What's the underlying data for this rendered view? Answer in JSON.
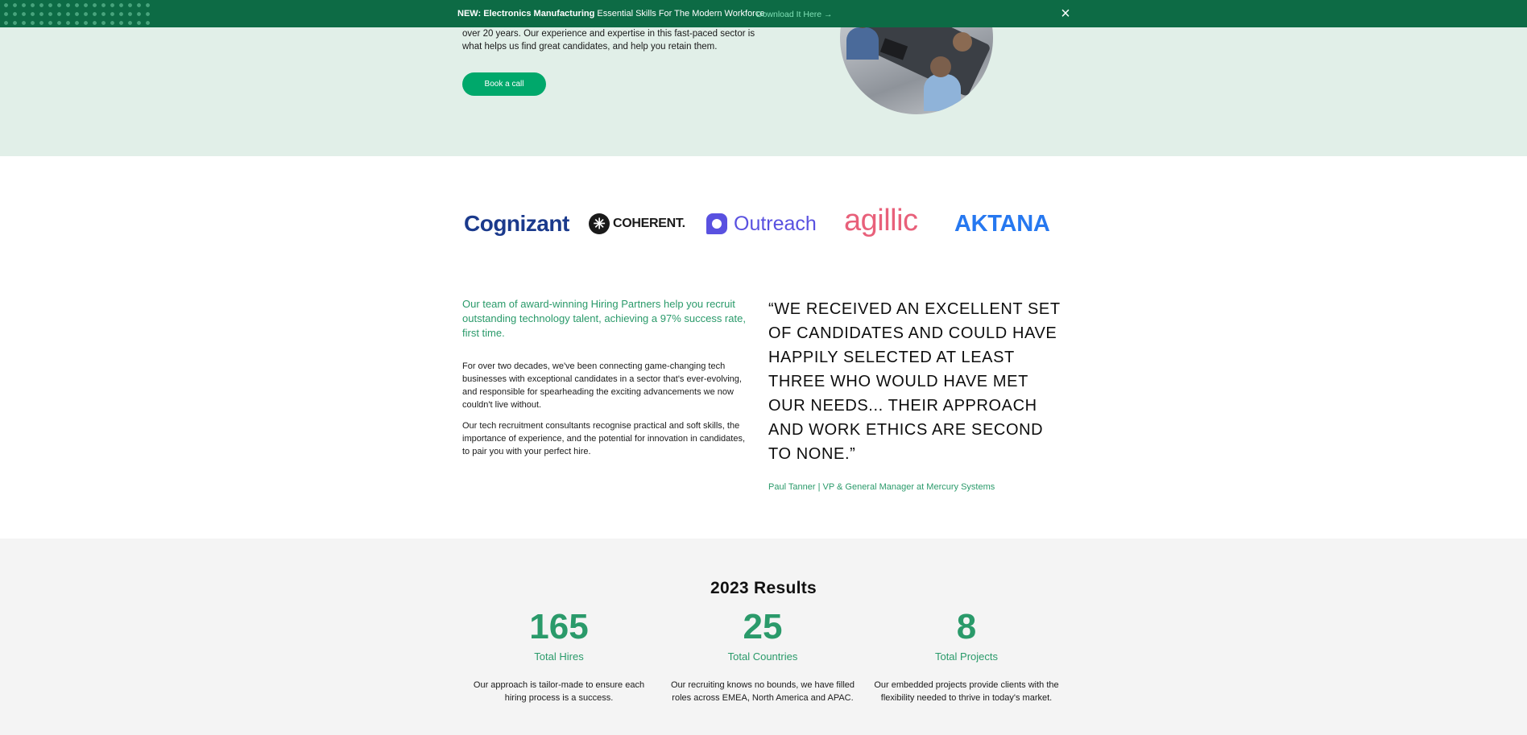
{
  "banner": {
    "prefix": "NEW:",
    "bold_text": "Electronics Manufacturing",
    "text": "Essential Skills For The Modern Workforce",
    "link_label": "Download It Here →",
    "close_icon": "×"
  },
  "hero": {
    "text": "over 20 years. Our experience and expertise in this fast-paced sector is what helps us find great candidates, and help you retain them.",
    "button_label": "Book a call"
  },
  "logos": {
    "cognizant": "Cognizant",
    "coherent": "COHERENT.",
    "coherent_mark": "✳",
    "outreach": "Outreach",
    "agillic": "agillic",
    "aktana": "AKTANA"
  },
  "intro": {
    "lead": "Our team of award-winning Hiring Partners help you recruit outstanding technology talent, achieving a 97% success rate, first time.",
    "paragraph_1": "For over two decades, we've been connecting game-changing tech businesses with exceptional candidates in a sector that's ever-evolving, and responsible for spearheading the exciting advancements we now couldn't live without.",
    "paragraph_2": "Our tech recruitment consultants recognise practical and soft skills, the importance of experience, and the potential for innovation in candidates, to pair you with your perfect hire."
  },
  "testimonial": {
    "quote": "“WE RECEIVED AN EXCELLENT SET OF CANDIDATES AND COULD HAVE HAPPILY SELECTED AT LEAST THREE WHO WOULD HAVE MET OUR NEEDS... THEIR APPROACH AND WORK ETHICS ARE SECOND TO NONE.”",
    "author": "Paul Tanner | VP & General Manager at Mercury Systems"
  },
  "results": {
    "title": "2023 Results",
    "stats": [
      {
        "number": "165",
        "label": "Total Hires",
        "description": "Our approach is tailor-made to ensure each hiring process is a success."
      },
      {
        "number": "25",
        "label": "Total Countries",
        "description": "Our recruiting knows no bounds, we have filled roles across EMEA, North America and APAC."
      },
      {
        "number": "8",
        "label": "Total Projects",
        "description": "Our embedded projects provide clients with the flexibility needed to thrive in today's market."
      }
    ]
  },
  "colors": {
    "brand_dark_green": "#0d6b45",
    "accent_green": "#2a9a6a",
    "button_green": "#00a86b",
    "hero_bg": "#e1efe8",
    "results_bg": "#f4f4f4"
  }
}
